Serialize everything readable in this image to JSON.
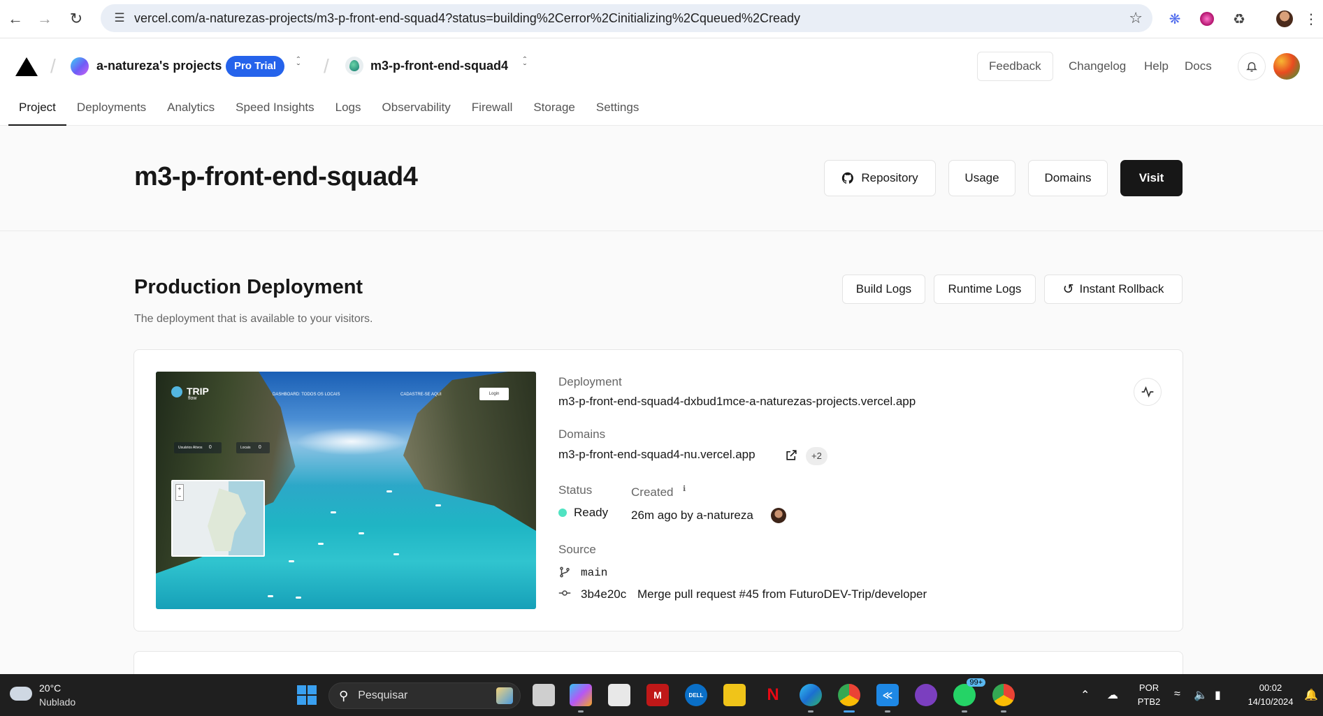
{
  "browser": {
    "url": "vercel.com/a-naturezas-projects/m3-p-front-end-squad4?status=building%2Cerror%2Cinitializing%2Cqueued%2Cready"
  },
  "header": {
    "team_name": "a-natureza's projects",
    "plan_badge": "Pro Trial",
    "project_name": "m3-p-front-end-squad4",
    "feedback": "Feedback",
    "links": [
      "Changelog",
      "Help",
      "Docs"
    ]
  },
  "tabs": [
    "Project",
    "Deployments",
    "Analytics",
    "Speed Insights",
    "Logs",
    "Observability",
    "Firewall",
    "Storage",
    "Settings"
  ],
  "project": {
    "title": "m3-p-front-end-squad4",
    "buttons": {
      "repository": "Repository",
      "usage": "Usage",
      "domains": "Domains",
      "visit": "Visit"
    }
  },
  "production": {
    "title": "Production Deployment",
    "subtitle": "The deployment that is available to your visitors.",
    "buttons": {
      "build_logs": "Build Logs",
      "runtime_logs": "Runtime Logs",
      "rollback": "Instant Rollback"
    },
    "preview": {
      "logo": "TRIP",
      "logo_sub": "flow",
      "nav1": "DASHBOARD: TODOS OS LOCAIS",
      "nav2": "CADASTRE-SE AQUI",
      "login": "Login",
      "stat1_label": "Usuários Ativos",
      "stat1_value": "0",
      "stat2_label": "Locais",
      "stat2_value": "0"
    },
    "deployment_label": "Deployment",
    "deployment_url": "m3-p-front-end-squad4-dxbud1mce-a-naturezas-projects.vercel.app",
    "domains_label": "Domains",
    "domain": "m3-p-front-end-squad4-nu.vercel.app",
    "domains_more": "+2",
    "status_label": "Status",
    "status_value": "Ready",
    "status_color": "#50e3c2",
    "created_label": "Created",
    "created_value": "26m ago by a-natureza",
    "source_label": "Source",
    "branch": "main",
    "commit_hash": "3b4e20c",
    "commit_message": "Merge pull request #45 from FuturoDEV-Trip/developer"
  },
  "taskbar": {
    "temperature": "20°C",
    "weather": "Nublado",
    "search_placeholder": "Pesquisar",
    "whatsapp_badge": "99+",
    "lang": "POR",
    "layout": "PTB2",
    "time": "00:02",
    "date": "14/10/2024"
  }
}
